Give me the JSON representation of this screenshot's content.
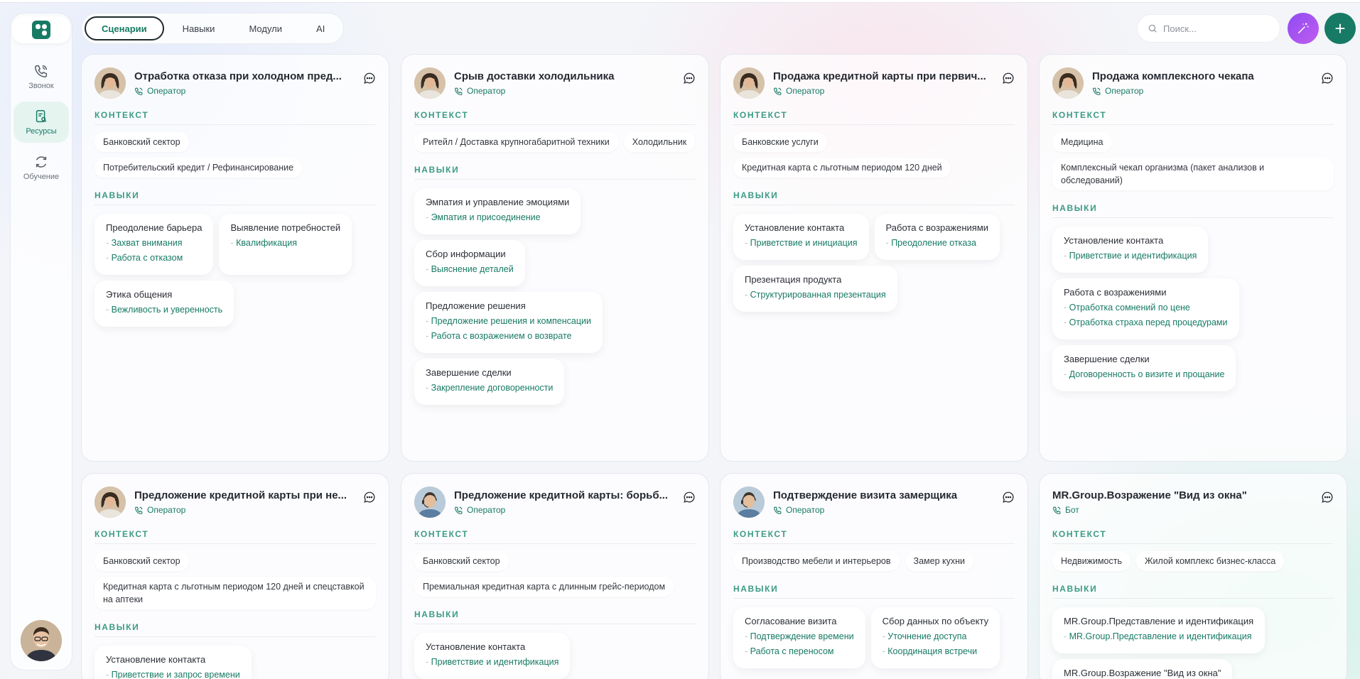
{
  "nav": {
    "items": [
      {
        "label": "Звонок",
        "icon": "phone-icon"
      },
      {
        "label": "Ресурсы",
        "icon": "resources-icon"
      },
      {
        "label": "Обучение",
        "icon": "refresh-icon"
      }
    ]
  },
  "tabs": [
    "Сценарии",
    "Навыки",
    "Модули",
    "AI"
  ],
  "search": {
    "placeholder": "Поиск..."
  },
  "section_labels": {
    "context": "КОНТЕКСТ",
    "skills": "НАВЫКИ"
  },
  "cards": [
    {
      "title": "Отработка отказа при холодном пред...",
      "role": "Оператор",
      "context": [
        "Банковский сектор",
        "Потребительский кредит / Рефинансирование"
      ],
      "skills": [
        {
          "name": "Преодоление барьера",
          "subs": [
            "Захват внимания",
            "Работа с отказом"
          ]
        },
        {
          "name": "Выявление потребностей",
          "subs": [
            "Квалификация"
          ]
        },
        {
          "name": "Этика общения",
          "subs": [
            "Вежливость и уверенность"
          ]
        }
      ]
    },
    {
      "title": "Срыв доставки холодильника",
      "role": "Оператор",
      "context": [
        "Ритейл / Доставка крупногабаритной техники",
        "Холодильник"
      ],
      "skills": [
        {
          "name": "Эмпатия и управление эмоциями",
          "subs": [
            "Эмпатия и присоединение"
          ]
        },
        {
          "name": "Сбор информации",
          "subs": [
            "Выяснение деталей"
          ]
        },
        {
          "name": "Предложение решения",
          "subs": [
            "Предложение решения и компенсации",
            "Работа с возражением о возврате"
          ]
        },
        {
          "name": "Завершение сделки",
          "subs": [
            "Закрепление договоренности"
          ]
        }
      ]
    },
    {
      "title": "Продажа кредитной карты при первич...",
      "role": "Оператор",
      "context": [
        "Банковские услуги",
        "Кредитная карта с льготным периодом 120 дней"
      ],
      "skills": [
        {
          "name": "Установление контакта",
          "subs": [
            "Приветствие и инициация"
          ]
        },
        {
          "name": "Работа с возражениями",
          "subs": [
            "Преодоление отказа"
          ]
        },
        {
          "name": "Презентация продукта",
          "subs": [
            "Структурированная презентация"
          ]
        }
      ]
    },
    {
      "title": "Продажа комплексного чекапа",
      "role": "Оператор",
      "context": [
        "Медицина",
        "Комплексный чекап организма (пакет анализов и обследований)"
      ],
      "skills": [
        {
          "name": "Установление контакта",
          "subs": [
            "Приветствие и идентификация"
          ]
        },
        {
          "name": "Работа с возражениями",
          "subs": [
            "Отработка сомнений по цене",
            "Отработка страха перед процедурами"
          ]
        },
        {
          "name": "Завершение сделки",
          "subs": [
            "Договоренность о визите и прощание"
          ]
        }
      ]
    },
    {
      "title": "Предложение кредитной карты при не...",
      "role": "Оператор",
      "context": [
        "Банковский сектор",
        "Кредитная карта с льготным периодом 120 дней и спецставкой на аптеки"
      ],
      "skills": [
        {
          "name": "Установление контакта",
          "subs": [
            "Приветствие и запрос времени"
          ]
        }
      ]
    },
    {
      "title": "Предложение кредитной карты: борьб...",
      "role": "Оператор",
      "context": [
        "Банковский сектор",
        "Премиальная кредитная карта с длинным грейс-периодом"
      ],
      "skills": [
        {
          "name": "Установление контакта",
          "subs": [
            "Приветствие и идентификация"
          ]
        }
      ]
    },
    {
      "title": "Подтверждение визита замерщика",
      "role": "Оператор",
      "context": [
        "Производство мебели и интерьеров",
        "Замер кухни"
      ],
      "skills": [
        {
          "name": "Согласование визита",
          "subs": [
            "Подтверждение времени",
            "Работа с переносом"
          ]
        },
        {
          "name": "Сбор данных по объекту",
          "subs": [
            "Уточнение доступа",
            "Координация встречи"
          ]
        }
      ]
    },
    {
      "title": "MR.Group.Возражение \"Вид из окна\"",
      "role": "Бот",
      "context": [
        "Недвижимость",
        "Жилой комплекс бизнес-класса"
      ],
      "skills": [
        {
          "name": "MR.Group.Представление и идентификация",
          "subs": [
            "MR.Group.Представление и идентификация"
          ]
        },
        {
          "name": "MR.Group.Возражение \"Вид из окна\"",
          "subs": []
        }
      ]
    }
  ]
}
